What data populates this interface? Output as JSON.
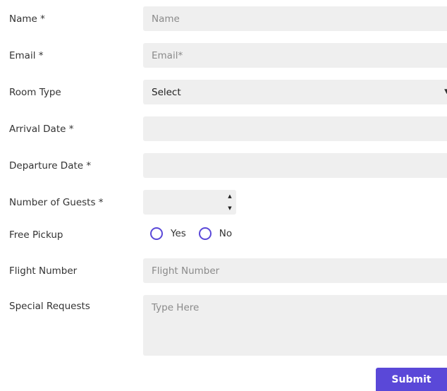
{
  "form": {
    "name": {
      "label": "Name *",
      "placeholder": "Name",
      "value": ""
    },
    "email": {
      "label": "Email *",
      "placeholder": "Email*",
      "value": ""
    },
    "room_type": {
      "label": "Room Type",
      "selected": "Select",
      "arrow_icon": "chevron-down-icon"
    },
    "arrival_date": {
      "label": "Arrival Date *",
      "value": ""
    },
    "departure_date": {
      "label": "Departure Date *",
      "value": ""
    },
    "guests": {
      "label": "Number of Guests *",
      "value": ""
    },
    "free_pickup": {
      "label": "Free Pickup",
      "options": [
        {
          "label": "Yes",
          "checked": false
        },
        {
          "label": "No",
          "checked": false
        }
      ]
    },
    "flight_number": {
      "label": "Flight Number",
      "placeholder": "Flight Number",
      "value": ""
    },
    "special_requests": {
      "label": "Special Requests",
      "placeholder": "Type Here",
      "value": ""
    },
    "submit_label": "Submit"
  },
  "colors": {
    "accent": "#5a48d8",
    "field_bg": "#efefef",
    "label_text": "#333333",
    "placeholder_text": "#8a8a8a"
  }
}
